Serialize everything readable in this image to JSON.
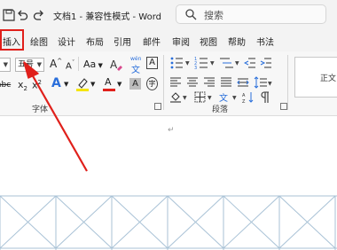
{
  "window": {
    "title": "文档1 - 兼容性模式 - Word",
    "search_label": "搜索"
  },
  "tabs": [
    {
      "label": "插入"
    },
    {
      "label": "绘图"
    },
    {
      "label": "设计"
    },
    {
      "label": "布局"
    },
    {
      "label": "引用"
    },
    {
      "label": "邮件"
    },
    {
      "label": "审阅"
    },
    {
      "label": "视图"
    },
    {
      "label": "帮助"
    },
    {
      "label": "书法"
    }
  ],
  "ribbon": {
    "font_size_value": "五号",
    "grow_font": "A",
    "shrink_font": "A",
    "change_case": "Aa",
    "char_border": "A",
    "font_color_letter": "A",
    "char_shading": "A",
    "strikethrough": "abc",
    "subscript": "x",
    "subscript_sub": "2",
    "superscript": "x",
    "superscript_sup": "2",
    "text_effect": "A",
    "phonetic_top": "wén",
    "phonetic_bottom": "文",
    "font_group_label": "字体",
    "paragraph_group_label": "段落",
    "style_normal": "正文"
  },
  "colors": {
    "highlight_red": "#e0201b",
    "font_color": "#e0201b",
    "highlight_yellow": "#f5e50c",
    "text_effect_blue": "#2a6fdb",
    "table_line": "#a9c2d6"
  }
}
